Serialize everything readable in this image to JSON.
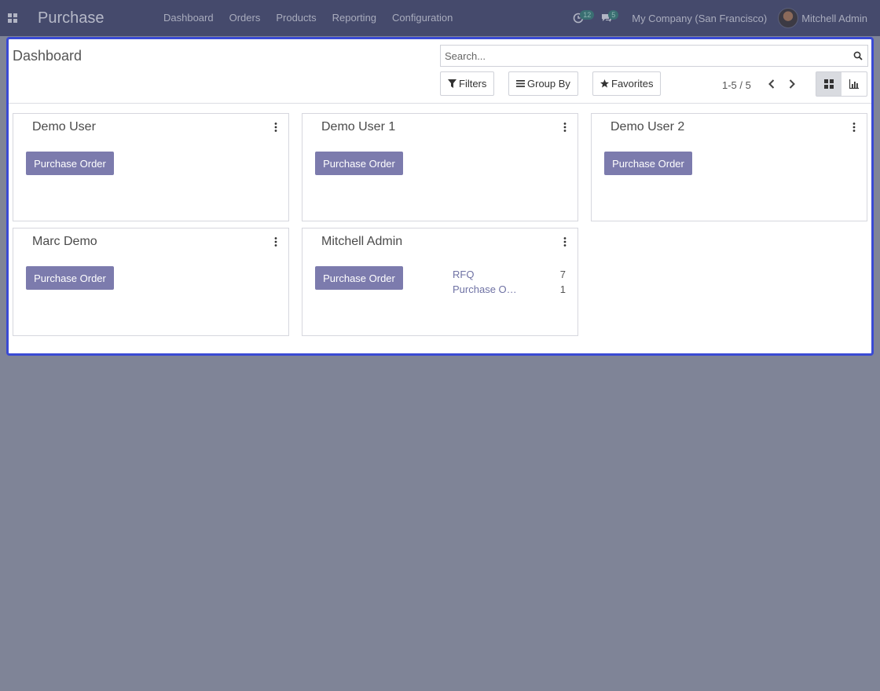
{
  "navbar": {
    "app_title": "Purchase",
    "menu": [
      "Dashboard",
      "Orders",
      "Products",
      "Reporting",
      "Configuration"
    ],
    "activity_count": "12",
    "messages_count": "5",
    "company": "My Company (San Francisco)",
    "user_name": "Mitchell Admin"
  },
  "control_panel": {
    "title": "Dashboard",
    "search_placeholder": "Search...",
    "filters_label": "Filters",
    "group_by_label": "Group By",
    "favorites_label": "Favorites",
    "pager": "1-5 / 5"
  },
  "cards": [
    {
      "title": "Demo User",
      "button": "Purchase Order",
      "stats": []
    },
    {
      "title": "Demo User 1",
      "button": "Purchase Order",
      "stats": []
    },
    {
      "title": "Demo User 2",
      "button": "Purchase Order",
      "stats": []
    },
    {
      "title": "Marc Demo",
      "button": "Purchase Order",
      "stats": []
    },
    {
      "title": "Mitchell Admin",
      "button": "Purchase Order",
      "stats": [
        {
          "label": "RFQ",
          "value": "7"
        },
        {
          "label": "Purchase O…",
          "value": "1"
        }
      ]
    }
  ],
  "colors": {
    "navbar_bg": "#454a6c",
    "overlay_bg": "#7f8497",
    "frame_border": "#3a4ad4",
    "primary_button": "#7c7bad",
    "link": "#6f72a4"
  }
}
